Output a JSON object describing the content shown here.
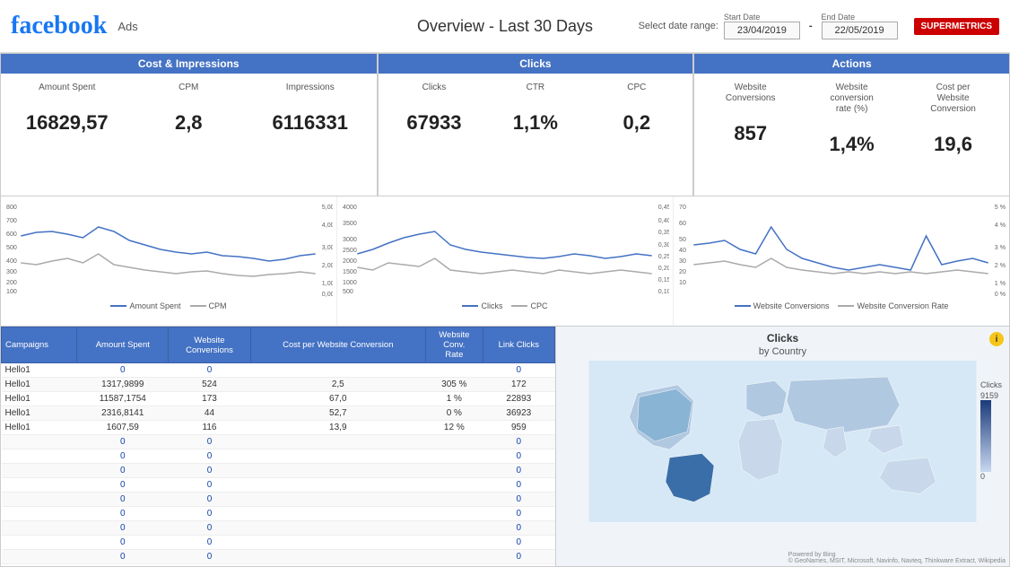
{
  "header": {
    "logo": "facebook",
    "ads_label": "Ads",
    "title": "Overview - Last 30 Days",
    "select_range_label": "Select date range:",
    "start_date_label": "Start Date",
    "end_date_label": "End Date",
    "start_date": "23/04/2019",
    "end_date": "22/05/2019",
    "supermetrics": "SUPERMETRICS"
  },
  "sections": {
    "cost_impressions": "Cost & Impressions",
    "clicks": "Clicks",
    "actions": "Actions"
  },
  "metrics": {
    "amount_spent_label": "Amount Spent",
    "cpm_label": "CPM",
    "impressions_label": "Impressions",
    "clicks_label": "Clicks",
    "ctr_label": "CTR",
    "cpc_label": "CPC",
    "website_conversions_label": "Website\nConversions",
    "website_conv_rate_label": "Website\nconversion\nrate (%)",
    "cost_per_website_conv_label": "Cost per\nWebsite\nConversion",
    "amount_spent_value": "16829,57",
    "cpm_value": "2,8",
    "impressions_value": "6116331",
    "clicks_value": "67933",
    "ctr_value": "1,1%",
    "cpc_value": "0,2",
    "website_conversions_value": "857",
    "website_conv_rate_value": "1,4%",
    "cost_per_website_conv_value": "19,6"
  },
  "table": {
    "headers": [
      "Campaigns",
      "Amount Spent",
      "Website\nConversions",
      "Cost per Website Conversion",
      "Website\nConv.\nRate",
      "Link Clicks"
    ],
    "rows": [
      [
        "Hello1",
        "0",
        "0",
        "",
        "",
        "0"
      ],
      [
        "Hello1",
        "1317,9899",
        "524",
        "2,5",
        "305 %",
        "172"
      ],
      [
        "Hello1",
        "11587,1754",
        "173",
        "67,0",
        "1 %",
        "22893"
      ],
      [
        "Hello1",
        "2316,8141",
        "44",
        "52,7",
        "0 %",
        "36923"
      ],
      [
        "Hello1",
        "1607,59",
        "116",
        "13,9",
        "12 %",
        "959"
      ],
      [
        "",
        "0",
        "0",
        "",
        "",
        "0"
      ],
      [
        "",
        "0",
        "0",
        "",
        "",
        "0"
      ],
      [
        "",
        "0",
        "0",
        "",
        "",
        "0"
      ],
      [
        "",
        "0",
        "0",
        "",
        "",
        "0"
      ],
      [
        "",
        "0",
        "0",
        "",
        "",
        "0"
      ],
      [
        "",
        "0",
        "0",
        "",
        "",
        "0"
      ],
      [
        "",
        "0",
        "0",
        "",
        "",
        "0"
      ],
      [
        "",
        "0",
        "0",
        "",
        "",
        "0"
      ],
      [
        "",
        "0",
        "0",
        "",
        "",
        "0"
      ]
    ]
  },
  "map": {
    "title": "Clicks",
    "subtitle": "by Country",
    "clicks_label": "Clicks",
    "max_value": "9159",
    "min_value": "0",
    "attribution": "© GeoNames, MSIT, Microsoft, Navinfo, Navteq, Thinkware Extract, Wikipedia",
    "powered_by": "Powered by Bing"
  },
  "chart1": {
    "legend1": "Amount Spent",
    "legend2": "CPM"
  },
  "chart2": {
    "legend1": "Clicks",
    "legend2": "CPC"
  },
  "chart3": {
    "legend1": "Website Conversions",
    "legend2": "Website Conversion Rate"
  }
}
